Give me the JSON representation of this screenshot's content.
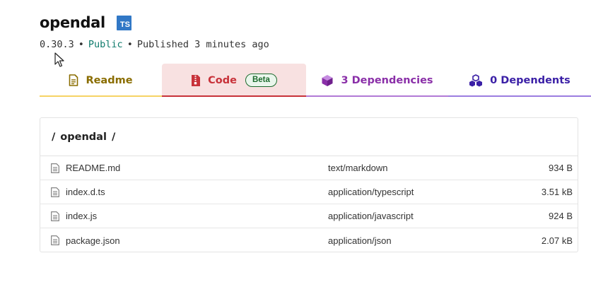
{
  "package": {
    "name": "opendal",
    "ts_badge": "TS",
    "version": "0.30.3",
    "visibility": "Public",
    "published": "Published 3 minutes ago",
    "separator": "•"
  },
  "tabs": [
    {
      "label": "Readme",
      "icon": "document-icon",
      "color": "#8a6d00"
    },
    {
      "label": "Code",
      "icon": "zip-file-icon",
      "color": "#c8323a",
      "badge": "Beta",
      "active": true
    },
    {
      "label": "3 Dependencies",
      "icon": "box-icon",
      "color": "#8a2fa8"
    },
    {
      "label": "0 Dependents",
      "icon": "boxes-icon",
      "color": "#3a1fa6"
    }
  ],
  "breadcrumb": {
    "root": "/",
    "dir": "opendal",
    "trail": "/"
  },
  "files": [
    {
      "name": "README.md",
      "type": "text/markdown",
      "size": "934 B"
    },
    {
      "name": "index.d.ts",
      "type": "application/typescript",
      "size": "3.51 kB"
    },
    {
      "name": "index.js",
      "type": "application/javascript",
      "size": "924 B"
    },
    {
      "name": "package.json",
      "type": "application/json",
      "size": "2.07 kB"
    }
  ],
  "colors": {
    "ts_blue": "#3178c6",
    "public_green": "#0f7b6c",
    "code_tab_bg": "#f8e1e1"
  }
}
